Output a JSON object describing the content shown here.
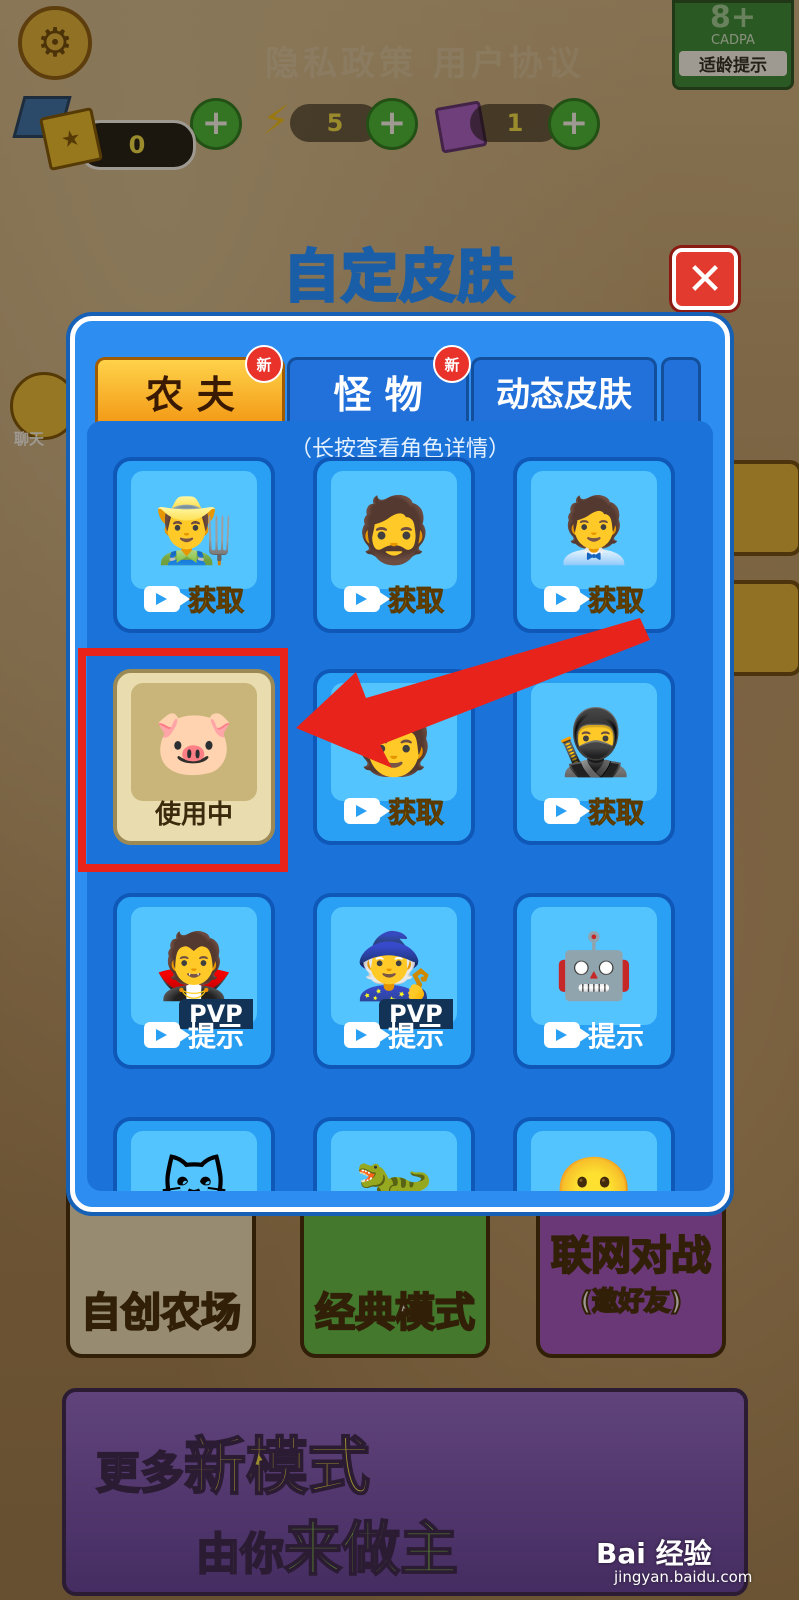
{
  "hud": {
    "title_faded": "隐私政策   用户协议",
    "cadpa_age": "8+",
    "cadpa_label": "CADPA",
    "cadpa_tip": "适龄提示",
    "ticket_count": "0",
    "energy_count": "5",
    "pass_count": "1",
    "plus": "+"
  },
  "side": {
    "chat_label": "聊天"
  },
  "dialog": {
    "title": "自定皮肤",
    "close": "✕",
    "tabs": [
      {
        "label": "农 夫",
        "badge": "新",
        "active": true
      },
      {
        "label": "怪 物",
        "badge": "新",
        "active": false
      },
      {
        "label": "动态皮肤",
        "active": false
      }
    ],
    "hint": "（长按查看角色详情）",
    "cards": [
      {
        "icon": "👨‍🌾",
        "action": "获取",
        "style": "get"
      },
      {
        "icon": "🧔",
        "action": "获取",
        "style": "get"
      },
      {
        "icon": "🧑‍💼",
        "action": "获取",
        "style": "get"
      },
      {
        "icon": "🐷",
        "action": "使用中",
        "style": "inuse"
      },
      {
        "icon": "🧑",
        "action": "获取",
        "style": "get"
      },
      {
        "icon": "🥷",
        "action": "获取",
        "style": "get"
      },
      {
        "icon": "🧛",
        "action": "提示",
        "style": "hint",
        "tag": "PVP"
      },
      {
        "icon": "🧙",
        "action": "提示",
        "style": "hint",
        "tag": "PVP"
      },
      {
        "icon": "🤖",
        "action": "提示",
        "style": "hint"
      },
      {
        "icon": "🐱"
      },
      {
        "icon": "🦖"
      },
      {
        "icon": "🙂"
      }
    ]
  },
  "modes": {
    "create_farm": "自创农场",
    "classic": "经典模式",
    "online": "联网对战",
    "online_sub": "(邀好友)"
  },
  "banner": {
    "more": "更多",
    "new_modes": "新模式",
    "by_you": "由你",
    "decide": "来做主"
  },
  "watermark": {
    "brand": "Bai 经验",
    "url": "jingyan.baidu.com"
  },
  "colors": {
    "panel_blue": "#2d8df0",
    "tab_active": "#f39a16",
    "annotation_red": "#e8231c"
  }
}
